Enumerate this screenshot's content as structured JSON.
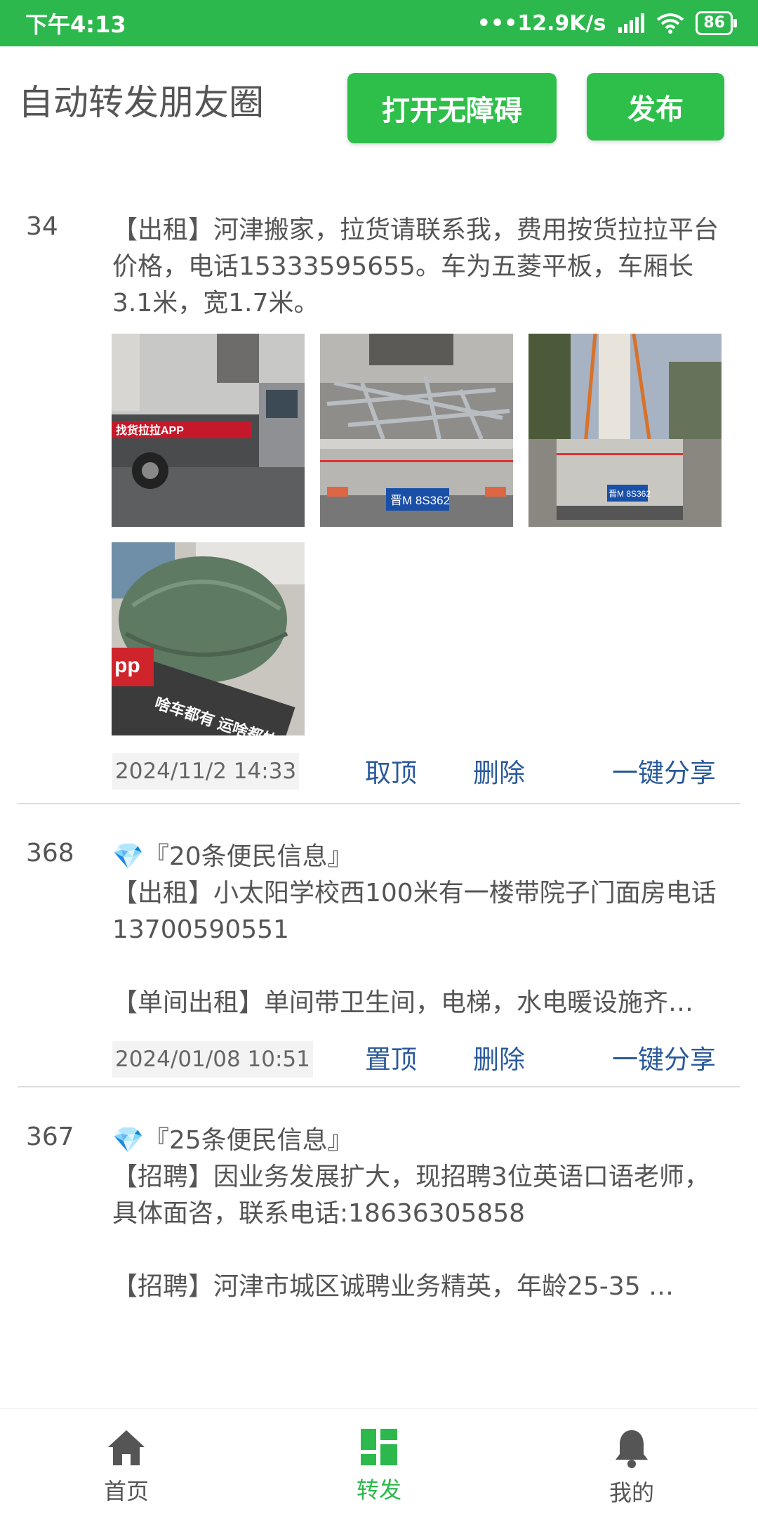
{
  "status_bar": {
    "time": "下午4:13",
    "net_speed": "•••12.9K/s",
    "battery": "86"
  },
  "header": {
    "title": "自动转发朋友圈",
    "a11y_button": "打开无障碍",
    "publish_button": "发布"
  },
  "posts": [
    {
      "number": "34",
      "text": "【出租】河津搬家，拉货请联系我，费用按货拉拉平台价格，电话15333595655。车为五菱平板，车厢长3.1米，宽1.7米。",
      "time": "2024/11/2 14:33",
      "pin_action": "取顶",
      "delete_action": "删除",
      "share_action": "一键分享",
      "photo_labels": [
        "找货拉拉APP",
        "晋M 8S362",
        "晋M 8S362",
        "啥车都有 运啥都快"
      ]
    },
    {
      "number": "368",
      "heading": "💎『20条便民信息』",
      "text": "【出租】小太阳学校西100米有一楼带院子门面房电话13700590551\n\n【单间出租】单间带卫生间，电梯，水电暖设施齐…",
      "time": "2024/01/08 10:51",
      "pin_action": "置顶",
      "delete_action": "删除",
      "share_action": "一键分享"
    },
    {
      "number": "367",
      "heading": "💎『25条便民信息』",
      "text": "【招聘】因业务发展扩大，现招聘3位英语口语老师，具体面咨，联系电话:18636305858\n\n【招聘】河津市城区诚聘业务精英，年龄25-35 …"
    }
  ],
  "bottom_nav": {
    "home": "首页",
    "forward": "转发",
    "mine": "我的"
  },
  "colors": {
    "brand": "#2db84d",
    "link": "#2a5a9a"
  }
}
